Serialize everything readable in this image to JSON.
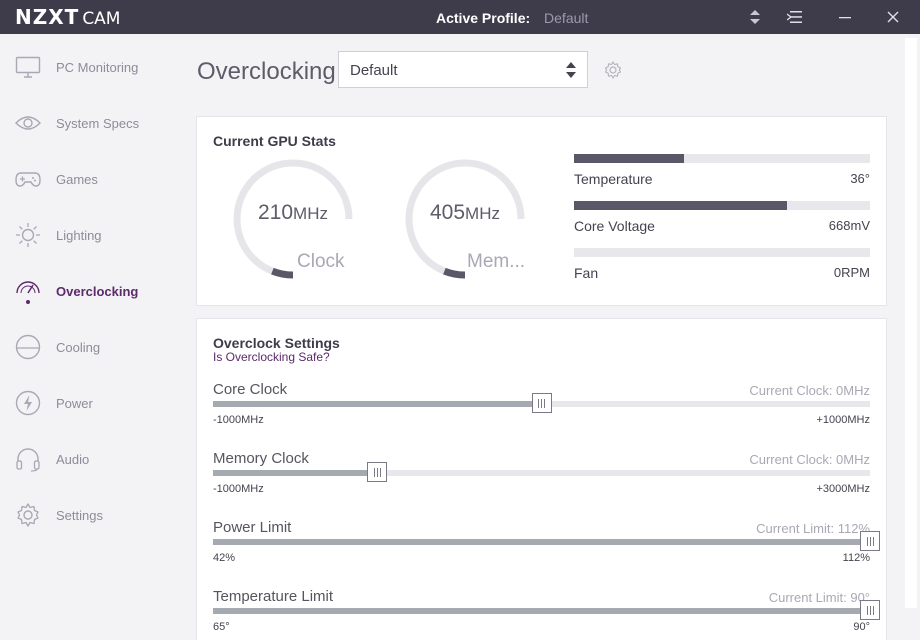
{
  "titlebar": {
    "logo_main": "NZXT",
    "logo_sub": "CAM",
    "profile_label": "Active Profile:",
    "profile_value": "Default",
    "buttons": [
      "sort-icon",
      "menu-icon",
      "minimize-icon",
      "close-icon"
    ]
  },
  "sidebar": {
    "items": [
      {
        "label": "PC Monitoring",
        "icon": "monitor-icon"
      },
      {
        "label": "System Specs",
        "icon": "eye-icon"
      },
      {
        "label": "Games",
        "icon": "gamepad-icon"
      },
      {
        "label": "Lighting",
        "icon": "sun-icon"
      },
      {
        "label": "Overclocking",
        "icon": "speedometer-icon"
      },
      {
        "label": "Cooling",
        "icon": "fan-icon"
      },
      {
        "label": "Power",
        "icon": "bolt-icon"
      },
      {
        "label": "Audio",
        "icon": "headphones-icon"
      },
      {
        "label": "Settings",
        "icon": "gear-icon"
      }
    ],
    "active_item": "Overclocking"
  },
  "main": {
    "title": "Overclocking",
    "profile_select": {
      "value": "Default"
    },
    "gpu_stats": {
      "title": "Current GPU Stats",
      "gauges": [
        {
          "value": "210",
          "unit": "MHz",
          "caption": "Clock",
          "level": 0.08
        },
        {
          "value": "405",
          "unit": "MHz",
          "caption": "Mem...",
          "level": 0.08
        }
      ],
      "stats": [
        {
          "label": "Temperature",
          "value": "36°",
          "level": 0.37
        },
        {
          "label": "Core Voltage",
          "value": "668mV",
          "level": 0.72
        },
        {
          "label": "Fan",
          "value": "0RPM",
          "level": 0
        }
      ]
    },
    "overclock_settings": {
      "title": "Overclock Settings",
      "safety_link": "Is Overclocking Safe?",
      "sliders": [
        {
          "label": "Core Clock",
          "current": "Current Clock: 0MHz",
          "min": "-1000MHz",
          "max": "+1000MHz",
          "level": 0.5
        },
        {
          "label": "Memory Clock",
          "current": "Current Clock: 0MHz",
          "min": "-1000MHz",
          "max": "+3000MHz",
          "level": 0.25
        },
        {
          "label": "Power Limit",
          "current": "Current Limit: 112%",
          "min": "42%",
          "max": "112%",
          "level": 1.0
        },
        {
          "label": "Temperature Limit",
          "current": "Current Limit: 90°",
          "min": "65°",
          "max": "90°",
          "level": 1.0
        }
      ]
    }
  },
  "colors": {
    "titlebar": "#3e3c4b",
    "accent": "#5b2a6b",
    "bar_fill": "#5a5868",
    "slider_fill": "#a4aab0"
  }
}
